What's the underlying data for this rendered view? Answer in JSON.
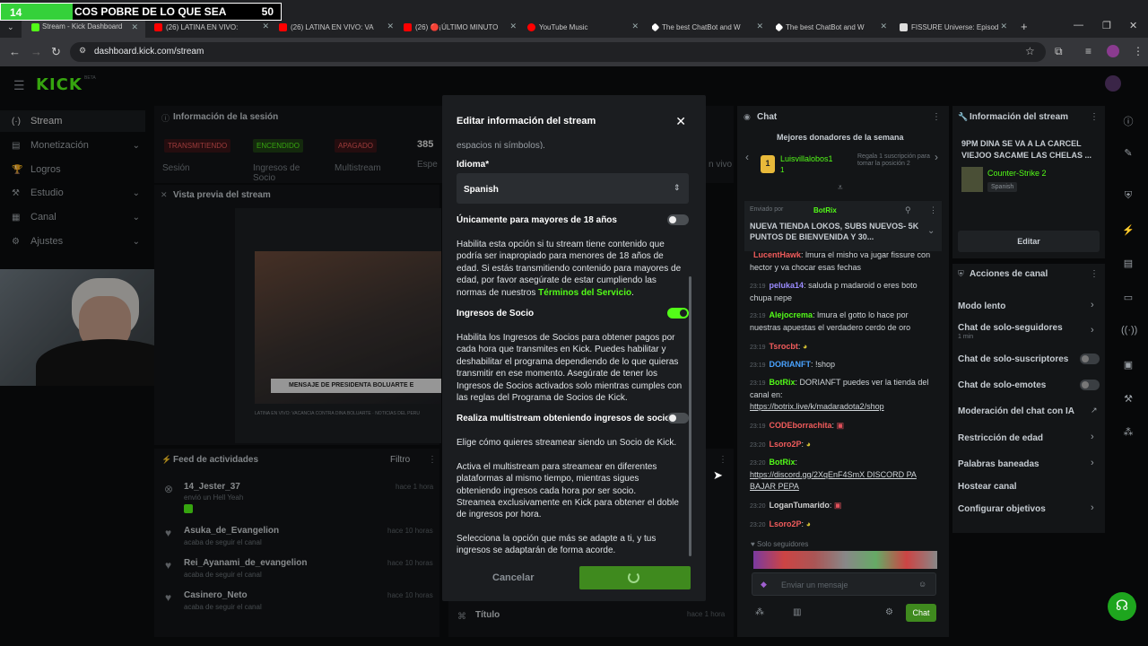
{
  "counter": {
    "level": "14",
    "title": "COS POBRE DE LO QUE SEA",
    "count": "50"
  },
  "tabs": [
    {
      "label": "Stream - Kick Dashboard",
      "color": "#53fc18"
    },
    {
      "label": "(26) LATINA EN VIVO:",
      "color": "#ff0000"
    },
    {
      "label": "(26) LATINA EN VIVO: VA",
      "color": "#ff0000"
    },
    {
      "label": "(26) 🔴¡ÚLTIMO MINUTO",
      "color": "#ff0000"
    },
    {
      "label": "YouTube Music",
      "color": "#ff0000"
    },
    {
      "label": "The best ChatBot and W",
      "color": "#ffffff"
    },
    {
      "label": "The best ChatBot and W",
      "color": "#ffffff"
    },
    {
      "label": "FISSURE Universe: Episod",
      "color": "#ffffff"
    }
  ],
  "url": "dashboard.kick.com/stream",
  "logo": "KICK",
  "logo_beta": "BETA",
  "sidebar": [
    {
      "label": "Stream",
      "icon": "(·)"
    },
    {
      "label": "Monetización",
      "icon": "▤"
    },
    {
      "label": "Logros",
      "icon": "🏆"
    },
    {
      "label": "Estudio",
      "icon": "⚒"
    },
    {
      "label": "Canal",
      "icon": "▦"
    },
    {
      "label": "Ajustes",
      "icon": "⚙"
    }
  ],
  "session": {
    "title": "Información de la sesión",
    "statuses": [
      {
        "badge": "TRANSMITIENDO",
        "label": "Sesión"
      },
      {
        "badge": "ENCENDIDO",
        "label": "Ingresos de Socio"
      },
      {
        "badge": "APAGADO",
        "label": "Multistream"
      }
    ],
    "viewers": "385",
    "viewers_label": "Espe",
    "live_label": "n vivo"
  },
  "preview": {
    "title": "Vista previa del stream",
    "banner": "MENSAJE DE PRESIDENTA BOLUARTE E",
    "caption": "LATINA EN VIVO: VACANCIA CONTRA DINA BOLUARTE · NOTICIAS DEL PERÚ"
  },
  "feed": {
    "title": "Feed de actividades",
    "filter": "Filtro",
    "items": [
      {
        "name": "14_Jester_37",
        "sub": "envió un Hell Yeah",
        "time": "hace 1 hora"
      },
      {
        "name": "Asuka_de_Evangelion",
        "sub": "acaba de seguir el canal",
        "time": "hace 10 horas"
      },
      {
        "name": "Rei_Ayanami_de_evangelion",
        "sub": "acaba de seguir el canal",
        "time": "hace 10 horas"
      },
      {
        "name": "Casinero_Neto",
        "sub": "acaba de seguir el canal",
        "time": "hace 10 horas"
      }
    ],
    "extra_title": "Título",
    "extra_time": "hace 1 hora"
  },
  "modal": {
    "title": "Editar información del stream",
    "top_cut": "espacios ni símbolos).",
    "idioma_label": "Idioma*",
    "idioma_value": "Spanish",
    "adult_label": "Únicamente para mayores de 18 años",
    "adult_text": "Habilita esta opción si tu stream tiene contenido que podría ser inapropiado para menores de 18 años de edad. Si estás transmitiendo contenido para mayores de edad, por favor asegúrate de estar cumpliendo las normas de nuestros",
    "adult_link": "Términos del Servicio",
    "partner_label": "Ingresos de Socio",
    "partner_text": "Habilita los Ingresos de Socios para obtener pagos por cada hora que transmites en Kick. Puedes habilitar y deshabilitar el programa dependiendo de lo que quieras transmitir en ese momento. Asegúrate de tener los Ingresos de Socios activados solo mientras cumples con las reglas del Programa de Socios de Kick.",
    "multi_label": "Realiza multistream obteniendo ingresos de socio",
    "multi_text1": "Elige cómo quieres streamear siendo un Socio de Kick.",
    "multi_text2": "Activa el multistream para streamear en diferentes plataformas al mismo tiempo, mientras sigues obteniendo ingresos cada hora por ser socio.",
    "multi_text3": "Streamea exclusivamente en Kick para obtener el doble de ingresos por hora.",
    "multi_text4": "Selecciona la opción que más se adapte a ti, y tus ingresos se adaptarán de forma acorde.",
    "cancel": "Cancelar"
  },
  "chat": {
    "title": "Chat",
    "donors_title": "Mejores donadores de la semana",
    "donor_name": "Luisvillalobos1",
    "donor_count": "1",
    "donor_hint": "Regala 1 suscripción para tomar la posición 2",
    "pinned_by": "Enviado por",
    "pinned_user": "BotRix",
    "pinned_text": "NUEVA TIENDA LOKOS, SUBS NUEVOS- 5K PUNTOS DE BIENVENIDA Y 30...",
    "messages": [
      {
        "time": "",
        "user": "LucentHawk",
        "text": ": lmura el misho va jugar fissure con hector y va chocar esas fechas",
        "color": "#f25c5c"
      },
      {
        "time": "23:19",
        "user": "peluka14",
        "text": ": saluda p madaroid o eres boto chupa nepe",
        "color": "#9b8cff"
      },
      {
        "time": "23:19",
        "user": "Alejocrema",
        "text": ": lmura el gotto lo hace por nuestras apuestas el verdadero cerdo de oro",
        "color": "#53fc18"
      },
      {
        "time": "23:19",
        "user": "Tsrocbt",
        "text": ":",
        "color": "#f25c5c"
      },
      {
        "time": "23:19",
        "user": "DORIANFT",
        "text": ": !shop",
        "color": "#4aa3ff"
      },
      {
        "time": "23:19",
        "user": "BotRix",
        "text": ": DORIANFT puedes ver la tienda del canal en:",
        "color": "#53fc18"
      },
      {
        "time": "",
        "user": "",
        "text": "https://botrix.live/k/madaradota2/shop",
        "color": "#cfd4d8"
      },
      {
        "time": "23:19",
        "user": "CODEborrachita",
        "text": ":",
        "color": "#f25c5c"
      },
      {
        "time": "23:20",
        "user": "Lsoro2P",
        "text": ":",
        "color": "#f25c5c"
      },
      {
        "time": "23:20",
        "user": "BotRix",
        "text": ":",
        "color": "#53fc18"
      },
      {
        "time": "",
        "user": "",
        "text": "https://discord.gg/2XqEnF4SmX DISCORD PA BAJAR PEPA",
        "color": "#cfd4d8"
      },
      {
        "time": "23:20",
        "user": "LoganTumarido",
        "text": ":",
        "color": "#d0d0d0"
      },
      {
        "time": "23:20",
        "user": "Lsoro2P",
        "text": ":",
        "color": "#f25c5c"
      }
    ],
    "followers_only": "Solo seguidores",
    "input_placeholder": "Enviar un mensaje",
    "send": "Chat"
  },
  "stream_info": {
    "title": "Información del stream",
    "stream_title": "9PM DINA SE VA A LA CARCEL VIEJOO SACAME LAS CHELAS ...",
    "category": "Counter-Strike 2",
    "language_tag": "Spanish",
    "edit": "Editar"
  },
  "actions": {
    "title": "Acciones de canal",
    "items": [
      {
        "label": "Modo lento",
        "sub": "",
        "kind": "chev"
      },
      {
        "label": "Chat de solo-seguidores",
        "sub": "1 min",
        "kind": "chev"
      },
      {
        "label": "Chat de solo-suscriptores",
        "sub": "",
        "kind": "switch"
      },
      {
        "label": "Chat de solo-emotes",
        "sub": "",
        "kind": "switch"
      },
      {
        "label": "Moderación del chat con IA",
        "sub": "",
        "kind": "link"
      },
      {
        "label": "Restricción de edad",
        "sub": "",
        "kind": "chev"
      },
      {
        "label": "Palabras baneadas",
        "sub": "",
        "kind": "chev"
      },
      {
        "label": "Hostear canal",
        "sub": "",
        "kind": "none"
      },
      {
        "label": "Configurar objetivos",
        "sub": "",
        "kind": "chev"
      }
    ]
  }
}
